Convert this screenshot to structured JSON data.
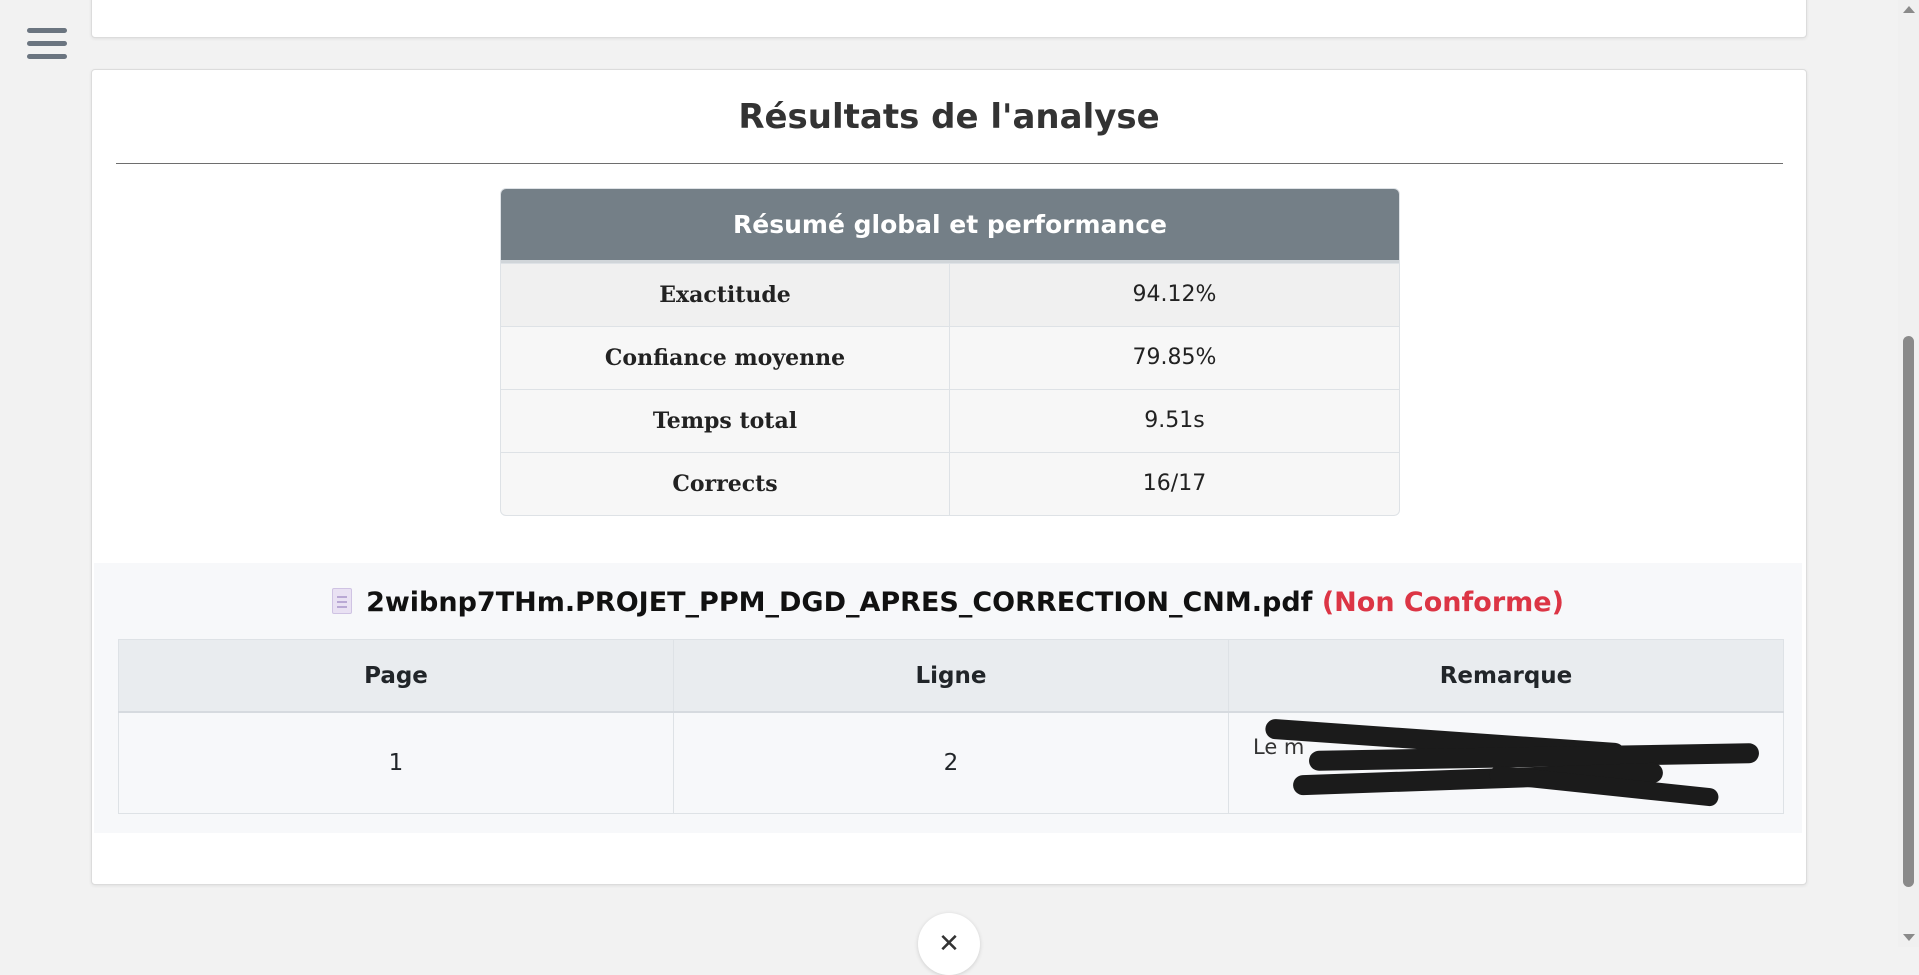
{
  "analysis": {
    "title": "Résultats de l'analyse",
    "summary": {
      "header": "Résumé global et performance",
      "rows": [
        {
          "label": "Exactitude",
          "value": "94.12%"
        },
        {
          "label": "Confiance moyenne",
          "value": "79.85%"
        },
        {
          "label": "Temps total",
          "value": "9.51s"
        },
        {
          "label": "Corrects",
          "value": "16/17"
        }
      ]
    },
    "file": {
      "name": "2wibnp7THm.PROJET_PPM_DGD_APRES_CORRECTION_CNM.pdf",
      "status": "(Non Conforme)",
      "status_color": "#dc3545",
      "icon": "document-icon",
      "columns": [
        "Page",
        "Ligne",
        "Remarque"
      ],
      "rows": [
        {
          "page": "1",
          "line": "2",
          "remark": "Le m"
        }
      ]
    }
  },
  "icons": {
    "menu": "hamburger-menu-icon",
    "collapse": "chevron-down-icon"
  }
}
